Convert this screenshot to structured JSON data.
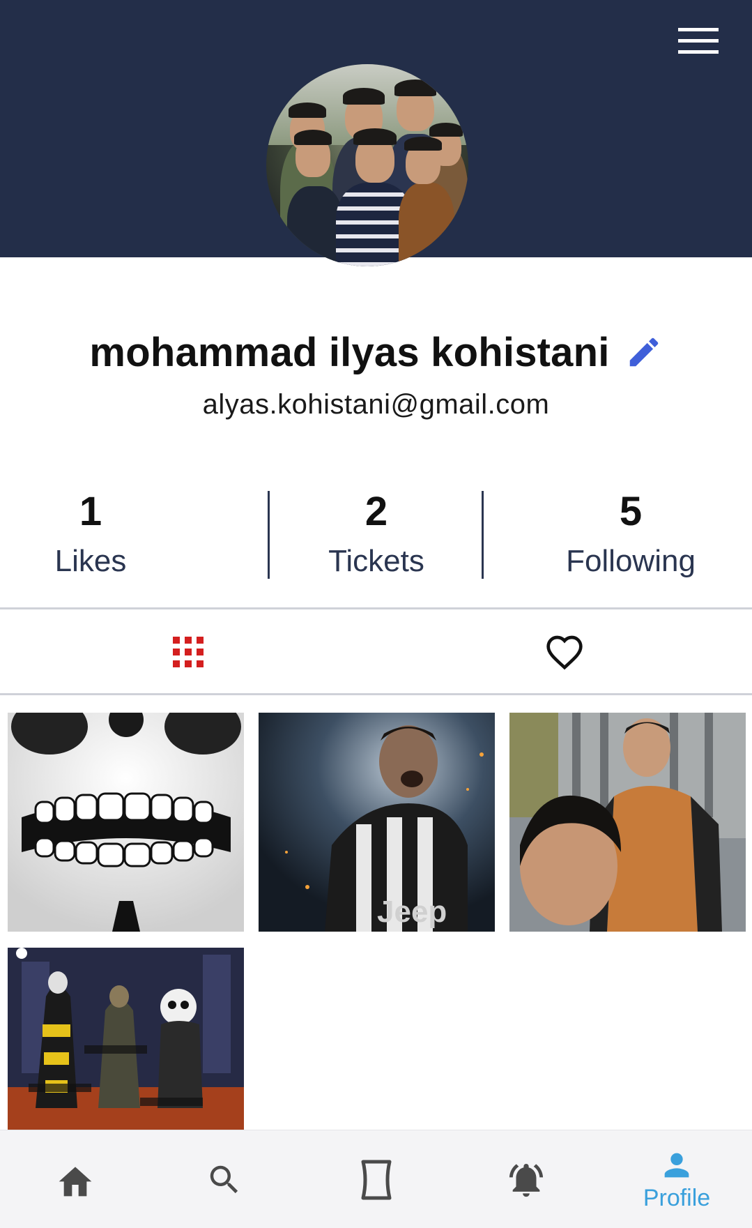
{
  "header": {
    "menu_icon": "hamburger-menu-icon",
    "background_color": "#232e49"
  },
  "profile": {
    "name": "mohammad ilyas kohistani",
    "email": "alyas.kohistani@gmail.com",
    "edit_icon": "pencil-edit-icon",
    "accent_color": "#3f5fd9"
  },
  "stats": [
    {
      "value": "1",
      "label": "Likes"
    },
    {
      "value": "2",
      "label": "Tickets"
    },
    {
      "value": "5",
      "label": "Following"
    }
  ],
  "tabs": {
    "posts_icon": "grid-icon",
    "likes_icon": "heart-outline-icon",
    "active_color": "#d41f1f"
  },
  "posts": [
    {
      "name": "skull-image"
    },
    {
      "name": "football-player-image"
    },
    {
      "name": "selfie-image"
    },
    {
      "name": "game-screenshot-image"
    }
  ],
  "bottom_nav": {
    "items": [
      {
        "icon": "home-icon",
        "label": ""
      },
      {
        "icon": "search-icon",
        "label": ""
      },
      {
        "icon": "ticket-icon",
        "label": ""
      },
      {
        "icon": "notification-bell-icon",
        "label": ""
      },
      {
        "icon": "profile-person-icon",
        "label": "Profile"
      }
    ],
    "active_color": "#3aa0dc",
    "inactive_color": "#4a4a4a"
  }
}
